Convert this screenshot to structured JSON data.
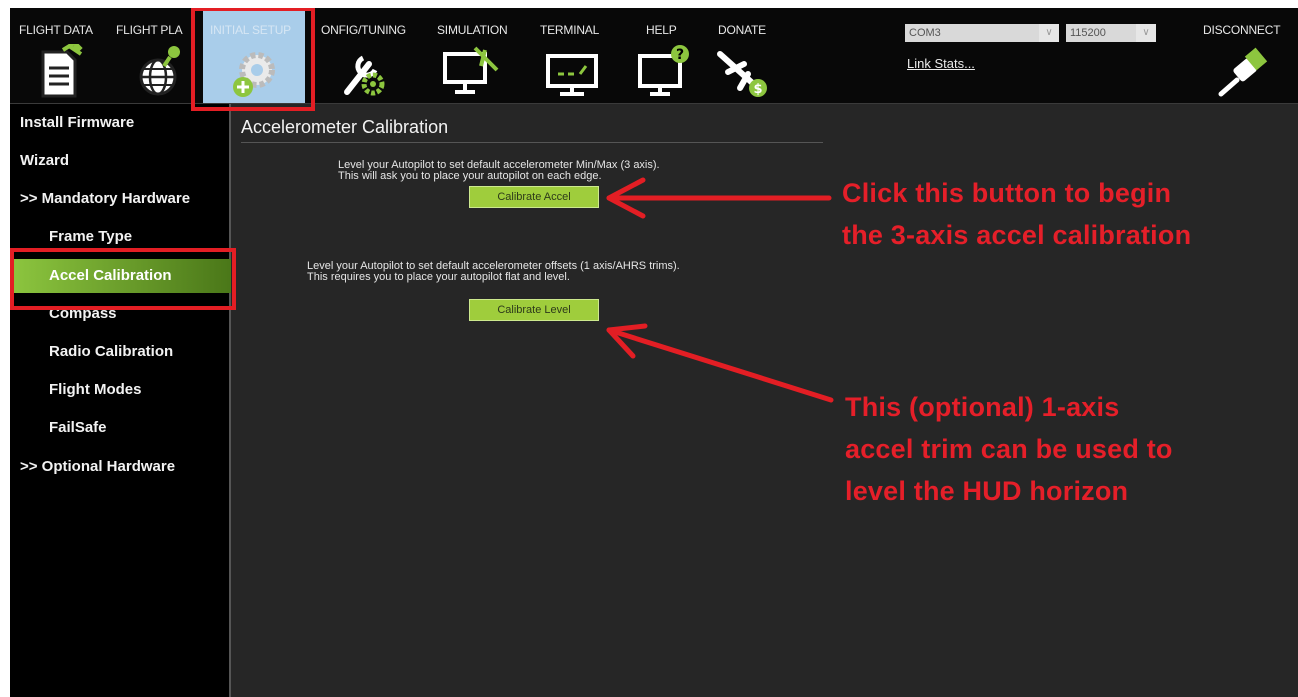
{
  "toolbar": {
    "items": [
      {
        "label": "FLIGHT DATA",
        "icon": "document-icon"
      },
      {
        "label": "FLIGHT PLA",
        "icon": "globe-key-icon"
      },
      {
        "label": "INITIAL SETUP",
        "icon": "gear-plus-icon",
        "active": true
      },
      {
        "label": "ONFIG/TUNING",
        "icon": "wrench-gear-icon"
      },
      {
        "label": "SIMULATION",
        "icon": "monitor-plane-icon"
      },
      {
        "label": "TERMINAL",
        "icon": "terminal-monitor-icon"
      },
      {
        "label": "HELP",
        "icon": "monitor-help-icon"
      },
      {
        "label": "DONATE",
        "icon": "plane-dollar-icon"
      }
    ],
    "port": "COM3",
    "baud": "115200",
    "link_stats": "Link Stats...",
    "disconnect": "DISCONNECT"
  },
  "sidebar": {
    "items": [
      {
        "label": "Install Firmware"
      },
      {
        "label": "Wizard"
      },
      {
        "label": ">> Mandatory Hardware"
      },
      {
        "label": "Frame Type"
      },
      {
        "label": "Accel Calibration",
        "active": true
      },
      {
        "label": "Compass"
      },
      {
        "label": "Radio Calibration"
      },
      {
        "label": "Flight Modes"
      },
      {
        "label": "FailSafe"
      },
      {
        "label": ">> Optional Hardware"
      }
    ]
  },
  "main": {
    "title": "Accelerometer Calibration",
    "accel_desc_line1": "Level your Autopilot to set default accelerometer Min/Max (3 axis).",
    "accel_desc_line2": "This will ask you to place your autopilot on each edge.",
    "calibrate_accel": "Calibrate Accel",
    "level_desc_line1": "Level your Autopilot to set default accelerometer offsets (1 axis/AHRS trims).",
    "level_desc_line2": "This requires you to place your autopilot flat and level.",
    "calibrate_level": "Calibrate Level"
  },
  "annotations": {
    "top_line1": "Click this button to begin",
    "top_line2": "the 3-axis accel calibration",
    "bottom_line1": "This (optional) 1-axis",
    "bottom_line2": "accel trim can be used to",
    "bottom_line3": "level the HUD horizon",
    "color": "#e51f29"
  },
  "colors": {
    "active_tab": "#a9cdea",
    "highlight": "#e31e24",
    "green_button": "#9fcd3c",
    "nav_active": "#8dc63f"
  }
}
